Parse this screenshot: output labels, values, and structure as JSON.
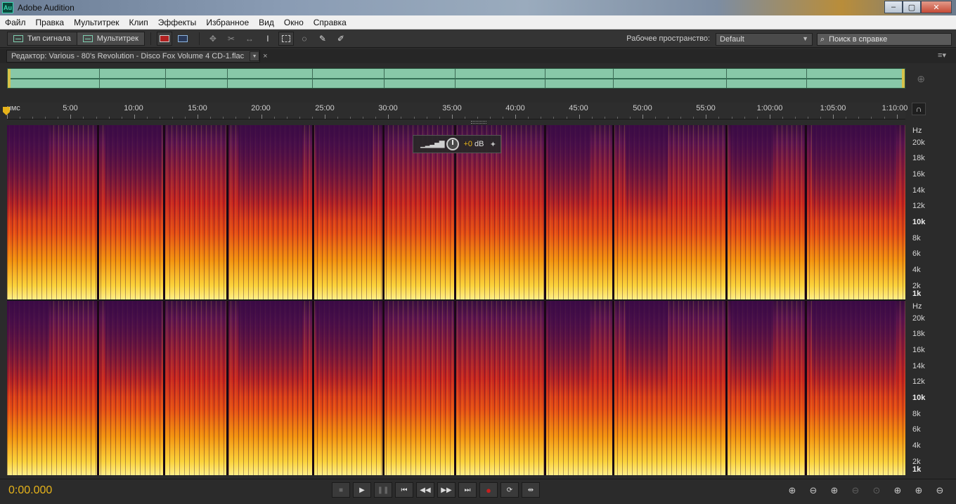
{
  "app": {
    "title": "Adobe Audition",
    "icon_text": "Au"
  },
  "window_controls": {
    "minimize": "–",
    "maximize": "▢",
    "close": "✕"
  },
  "menu": [
    "Файл",
    "Правка",
    "Мультитрек",
    "Клип",
    "Эффекты",
    "Избранное",
    "Вид",
    "Окно",
    "Справка"
  ],
  "toolbar": {
    "waveform_label": "Тип сигнала",
    "multitrack_label": "Мультитрек",
    "workspace_label": "Рабочее пространство:",
    "workspace_value": "Default",
    "search_placeholder": "Поиск в справке"
  },
  "editor_tab": {
    "label": "Редактор: Various - 80's Revolution - Disco Fox Volume 4 CD-1.flac",
    "close": "×"
  },
  "ruler": {
    "labels": [
      "чмс",
      "5:00",
      "10:00",
      "15:00",
      "20:00",
      "25:00",
      "30:00",
      "35:00",
      "40:00",
      "45:00",
      "50:00",
      "55:00",
      "1:00:00",
      "1:05:00",
      "1:10:00"
    ]
  },
  "hud": {
    "gain_value": "+0",
    "gain_unit": "dB"
  },
  "frequency_scale": {
    "unit": "Hz",
    "labels": [
      "20k",
      "18k",
      "16k",
      "14k",
      "12k",
      "10k",
      "8k",
      "6k",
      "4k",
      "2k",
      "1k"
    ],
    "bold_labels": [
      "10k",
      "1k"
    ]
  },
  "timecode": "0:00.000",
  "colors": {
    "accent": "#e6b31a",
    "overview": "#88c8a8",
    "spectral_high": "#fff08a",
    "spectral_low": "#3a1040"
  }
}
